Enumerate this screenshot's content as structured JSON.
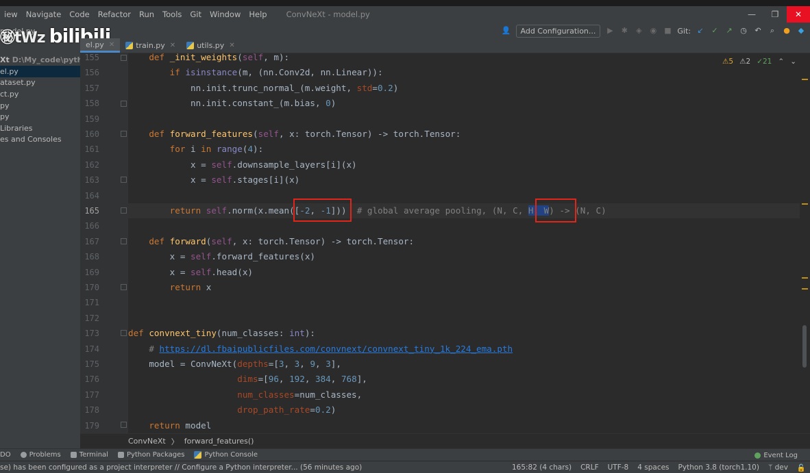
{
  "menu": {
    "items": [
      "iew",
      "Navigate",
      "Code",
      "Refactor",
      "Run",
      "Tools",
      "Git",
      "Window",
      "Help"
    ],
    "title": "ConvNeXt - model.py"
  },
  "toolbar": {
    "add_configuration": "Add Configuration...",
    "git_label": "Git:"
  },
  "tabs": [
    {
      "label": "el.py",
      "active": true
    },
    {
      "label": "train.py",
      "active": false
    },
    {
      "label": "utils.py",
      "active": false
    }
  ],
  "sidebar": {
    "items": [
      {
        "label": "model.py"
      },
      {
        "label": "Xt",
        "path": "D:\\My_code\\pythonP"
      },
      {
        "label": "el.py",
        "selected": true
      },
      {
        "label": "ataset.py"
      },
      {
        "label": "ct.py"
      },
      {
        "label": "py"
      },
      {
        "label": "py"
      },
      {
        "label": "Libraries"
      },
      {
        "label": "es and Consoles"
      }
    ]
  },
  "logo": {
    "left": "㊙tWz",
    "right": "bilibili"
  },
  "inspections": {
    "warnings": "5",
    "weak_warnings": "2",
    "typos": "21"
  },
  "editor": {
    "line_numbers": [
      "155",
      "156",
      "157",
      "158",
      "159",
      "160",
      "161",
      "162",
      "163",
      "164",
      "165",
      "166",
      "167",
      "168",
      "169",
      "170",
      "171",
      "172",
      "173",
      "174",
      "175",
      "176",
      "177",
      "178",
      "179"
    ],
    "current_line": "165"
  },
  "breadcrumb": {
    "class_name": "ConvNeXt",
    "method": "forward_features()"
  },
  "bottom_tools": {
    "todo": "DO",
    "problems": "Problems",
    "terminal": "Terminal",
    "python_packages": "Python Packages",
    "python_console": "Python Console",
    "event_log": "Event Log"
  },
  "status": {
    "message": "se) has been configured as a project interpreter // Configure a Python interpreter... (56 minutes ago)",
    "position": "165:82 (4 chars)",
    "line_sep": "CRLF",
    "encoding": "UTF-8",
    "indent": "4 spaces",
    "interpreter": "Python 3.8 (torch1.10)",
    "branch": "dev"
  },
  "colors": {
    "editor_bg": "#2b2b2b",
    "keyword": "#cc7832",
    "function": "#ffc66d",
    "number": "#6897bb",
    "annotation_box": "#e0251a"
  }
}
